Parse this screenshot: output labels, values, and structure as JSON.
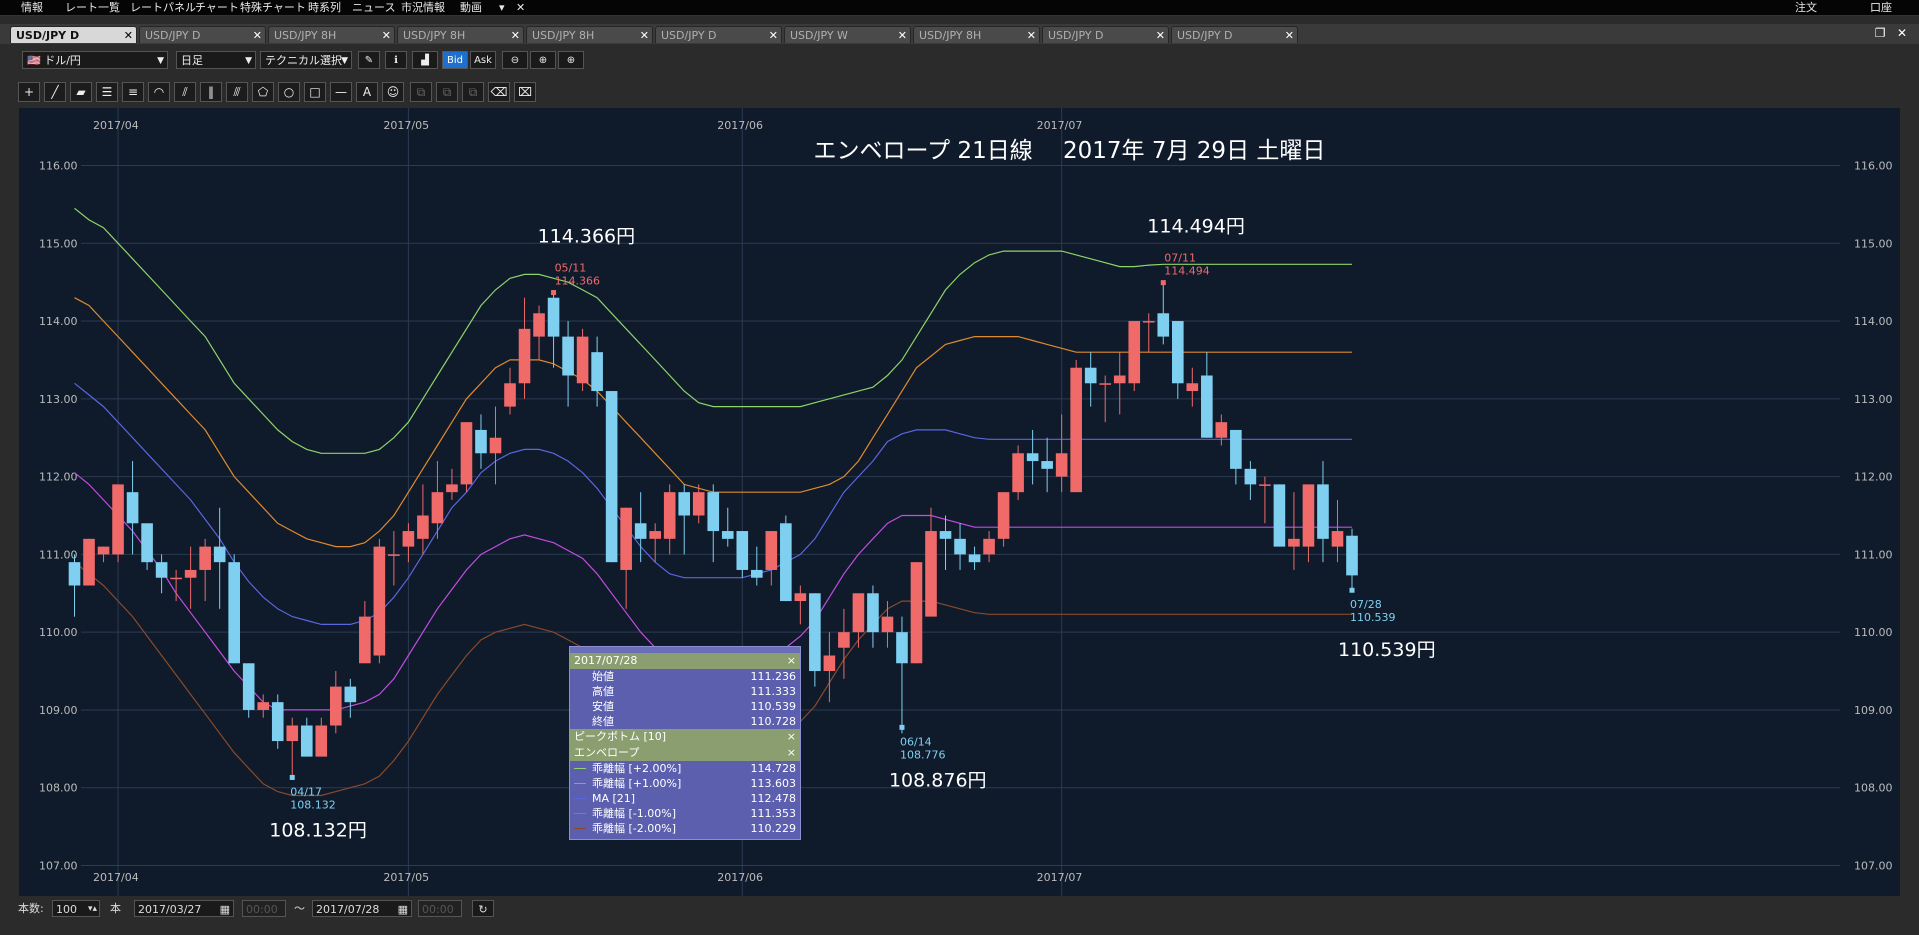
{
  "menubar": {
    "items": [
      "情報",
      "レート一覧",
      "レートパネル",
      "チャート",
      "特殊チャート",
      "時系列",
      "ニュース",
      "市況情報",
      "動画",
      "▾",
      "✕"
    ],
    "right": [
      "注文",
      "口座"
    ]
  },
  "tabs": [
    {
      "label": "USD/JPY D",
      "active": true
    },
    {
      "label": "USD/JPY D",
      "active": false
    },
    {
      "label": "USD/JPY 8H",
      "active": false
    },
    {
      "label": "USD/JPY 8H",
      "active": false
    },
    {
      "label": "USD/JPY 8H",
      "active": false
    },
    {
      "label": "USD/JPY D",
      "active": false
    },
    {
      "label": "USD/JPY W",
      "active": false
    },
    {
      "label": "USD/JPY 8H",
      "active": false
    },
    {
      "label": "USD/JPY D",
      "active": false
    },
    {
      "label": "USD/JPY D",
      "active": false
    }
  ],
  "toolbar": {
    "pair": "ドル/円",
    "period": "日足",
    "tech": "テクニカル選択",
    "bid": "Bid",
    "ask": "Ask"
  },
  "status": {
    "count_label": "本数:",
    "count_value": "100",
    "unit": "本",
    "start_date": "2017/03/27",
    "start_time": "00:00",
    "tilde": "〜",
    "end_date": "2017/07/28",
    "end_time": "00:00"
  },
  "infopanel": {
    "date": "2017/07/28",
    "ohlc": [
      {
        "label": "始値",
        "value": "111.236"
      },
      {
        "label": "高値",
        "value": "111.333"
      },
      {
        "label": "安値",
        "value": "110.539"
      },
      {
        "label": "終値",
        "value": "110.728"
      }
    ],
    "peak_label": "ピークボトム [10]",
    "env_label": "エンベロープ",
    "env_rows": [
      {
        "label": "乖離幅 [+2.00%]",
        "value": "114.728",
        "color": "#8fd46a"
      },
      {
        "label": "乖離幅 [+1.00%]",
        "value": "113.603",
        "color": "#e08a2c"
      },
      {
        "label": "MA [21]",
        "value": "112.478",
        "color": "#5a66e0"
      },
      {
        "label": "乖離幅 [-1.00%]",
        "value": "111.353",
        "color": "#c24de0"
      },
      {
        "label": "乖離幅 [-2.00%]",
        "value": "110.229",
        "color": "#8a4a2a"
      }
    ]
  },
  "chart_data": {
    "type": "candlestick",
    "title": "エンベロープ 21日線　 2017年 7月 29日 土曜日",
    "ylim": [
      107,
      116
    ],
    "yticks": [
      "116.00",
      "115.00",
      "114.00",
      "113.00",
      "112.00",
      "111.00",
      "110.00",
      "109.00",
      "108.00",
      "107.00"
    ],
    "month_labels": [
      {
        "label": "2017/04",
        "index": 3
      },
      {
        "label": "2017/05",
        "index": 23
      },
      {
        "label": "2017/06",
        "index": 46
      },
      {
        "label": "2017/07",
        "index": 68
      }
    ],
    "up_color": "#f06a6a",
    "down_color": "#7fd0f0",
    "candles": [
      [
        110.9,
        110.6,
        111.0,
        110.2
      ],
      [
        110.6,
        111.2,
        111.2,
        110.6
      ],
      [
        111.0,
        111.1,
        111.1,
        110.9
      ],
      [
        111.0,
        111.9,
        111.9,
        110.9
      ],
      [
        111.8,
        111.4,
        112.2,
        111.0
      ],
      [
        111.4,
        110.9,
        111.4,
        110.8
      ],
      [
        110.9,
        110.7,
        111.0,
        110.5
      ],
      [
        110.7,
        110.7,
        110.8,
        110.4
      ],
      [
        110.7,
        110.8,
        111.1,
        110.3
      ],
      [
        110.8,
        111.1,
        111.2,
        110.4
      ],
      [
        111.1,
        110.9,
        111.6,
        110.3
      ],
      [
        110.9,
        109.6,
        111.0,
        109.6
      ],
      [
        109.6,
        109.0,
        109.6,
        108.9
      ],
      [
        109.0,
        109.1,
        109.2,
        108.9
      ],
      [
        109.1,
        108.6,
        109.2,
        108.5
      ],
      [
        108.6,
        108.8,
        108.9,
        108.1
      ],
      [
        108.8,
        108.4,
        108.9,
        108.4
      ],
      [
        108.4,
        108.8,
        108.9,
        108.4
      ],
      [
        108.8,
        109.3,
        109.5,
        108.7
      ],
      [
        109.3,
        109.1,
        109.4,
        108.9
      ],
      [
        109.6,
        110.2,
        110.4,
        109.6
      ],
      [
        109.7,
        111.1,
        111.2,
        109.6
      ],
      [
        111.0,
        111.0,
        111.3,
        110.6
      ],
      [
        111.1,
        111.3,
        111.4,
        110.9
      ],
      [
        111.2,
        111.5,
        111.9,
        111.0
      ],
      [
        111.4,
        111.8,
        112.2,
        111.2
      ],
      [
        111.8,
        111.9,
        112.1,
        111.7
      ],
      [
        111.9,
        112.7,
        112.7,
        111.8
      ],
      [
        112.6,
        112.3,
        112.8,
        112.1
      ],
      [
        112.3,
        112.5,
        112.9,
        111.9
      ],
      [
        112.9,
        113.2,
        113.4,
        112.8
      ],
      [
        113.2,
        113.9,
        114.3,
        113.0
      ],
      [
        113.8,
        114.1,
        114.2,
        113.5
      ],
      [
        114.3,
        113.8,
        114.4,
        113.4
      ],
      [
        113.8,
        113.3,
        114.0,
        112.9
      ],
      [
        113.2,
        113.8,
        113.9,
        113.1
      ],
      [
        113.6,
        113.1,
        113.8,
        112.9
      ],
      [
        113.1,
        110.9,
        113.1,
        110.9
      ],
      [
        110.8,
        111.6,
        111.6,
        110.3
      ],
      [
        111.4,
        111.2,
        111.8,
        110.9
      ],
      [
        111.2,
        111.3,
        111.4,
        110.9
      ],
      [
        111.2,
        111.8,
        111.9,
        111.0
      ],
      [
        111.8,
        111.5,
        111.9,
        111.0
      ],
      [
        111.5,
        111.8,
        111.9,
        111.4
      ],
      [
        111.8,
        111.3,
        111.9,
        110.9
      ],
      [
        111.3,
        111.2,
        111.6,
        111.1
      ],
      [
        111.3,
        110.8,
        111.3,
        110.7
      ],
      [
        110.8,
        110.7,
        111.1,
        110.6
      ],
      [
        110.8,
        111.3,
        111.3,
        110.6
      ],
      [
        111.4,
        110.4,
        111.5,
        110.4
      ],
      [
        110.4,
        110.5,
        110.6,
        110.1
      ],
      [
        110.5,
        109.5,
        110.5,
        109.3
      ],
      [
        109.5,
        109.7,
        110.0,
        109.1
      ],
      [
        109.8,
        110.0,
        110.3,
        109.4
      ],
      [
        110.0,
        110.5,
        110.5,
        109.8
      ],
      [
        110.5,
        110.0,
        110.6,
        109.8
      ],
      [
        110.0,
        110.2,
        110.4,
        109.8
      ],
      [
        110.0,
        109.6,
        110.2,
        108.7
      ],
      [
        109.6,
        110.9,
        110.9,
        109.6
      ],
      [
        110.2,
        111.3,
        111.6,
        110.2
      ],
      [
        111.3,
        111.2,
        111.5,
        110.8
      ],
      [
        111.2,
        111.0,
        111.4,
        110.8
      ],
      [
        111.0,
        110.9,
        111.1,
        110.8
      ],
      [
        111.0,
        111.2,
        111.3,
        110.9
      ],
      [
        111.2,
        111.8,
        111.8,
        111.1
      ],
      [
        111.8,
        112.3,
        112.4,
        111.7
      ],
      [
        112.3,
        112.2,
        112.6,
        111.9
      ],
      [
        112.2,
        112.1,
        112.5,
        111.8
      ],
      [
        112.0,
        112.3,
        112.8,
        111.8
      ],
      [
        111.8,
        113.4,
        113.5,
        111.8
      ],
      [
        113.4,
        113.2,
        113.6,
        112.9
      ],
      [
        113.2,
        113.2,
        113.3,
        112.7
      ],
      [
        113.2,
        113.3,
        113.6,
        112.8
      ],
      [
        113.2,
        114.0,
        114.0,
        113.1
      ],
      [
        114.0,
        114.0,
        114.1,
        113.6
      ],
      [
        114.1,
        113.8,
        114.5,
        113.7
      ],
      [
        114.0,
        113.2,
        114.0,
        113.0
      ],
      [
        113.1,
        113.2,
        113.4,
        112.9
      ],
      [
        113.3,
        112.5,
        113.6,
        112.5
      ],
      [
        112.5,
        112.7,
        112.8,
        112.4
      ],
      [
        112.6,
        112.1,
        112.6,
        111.9
      ],
      [
        112.1,
        111.9,
        112.2,
        111.7
      ],
      [
        111.9,
        111.9,
        112.0,
        111.4
      ],
      [
        111.9,
        111.1,
        111.9,
        111.1
      ],
      [
        111.1,
        111.2,
        111.8,
        110.8
      ],
      [
        111.1,
        111.9,
        111.9,
        110.9
      ],
      [
        111.9,
        111.2,
        112.2,
        110.9
      ],
      [
        111.1,
        111.3,
        111.7,
        110.9
      ],
      [
        111.24,
        110.73,
        111.33,
        110.54
      ]
    ],
    "envelopes": [
      {
        "name": "乖離幅 [+2.00%]",
        "color": "#8fd46a",
        "values": [
          115.45,
          115.3,
          115.2,
          115.0,
          114.8,
          114.6,
          114.4,
          114.2,
          114.0,
          113.8,
          113.5,
          113.2,
          113.0,
          112.8,
          112.6,
          112.45,
          112.35,
          112.3,
          112.3,
          112.3,
          112.3,
          112.35,
          112.5,
          112.7,
          113.0,
          113.3,
          113.6,
          113.9,
          114.2,
          114.4,
          114.55,
          114.6,
          114.6,
          114.55,
          114.5,
          114.4,
          114.3,
          114.1,
          113.9,
          113.7,
          113.5,
          113.3,
          113.1,
          112.95,
          112.9,
          112.9,
          112.9,
          112.9,
          112.9,
          112.9,
          112.9,
          112.95,
          113.0,
          113.05,
          113.1,
          113.15,
          113.3,
          113.5,
          113.8,
          114.1,
          114.4,
          114.6,
          114.75,
          114.85,
          114.9,
          114.9,
          114.9,
          114.9,
          114.9,
          114.85,
          114.8,
          114.75,
          114.7,
          114.7,
          114.72,
          114.73,
          114.73,
          114.73,
          114.73,
          114.73,
          114.73,
          114.73,
          114.73,
          114.73,
          114.73,
          114.73,
          114.73,
          114.73,
          114.73
        ],
        "note": ""
      },
      {
        "name": "乖離幅 [+1.00%]",
        "color": "#e08a2c",
        "values": [
          114.3,
          114.2,
          114.0,
          113.8,
          113.6,
          113.4,
          113.2,
          113.0,
          112.8,
          112.6,
          112.3,
          112.0,
          111.8,
          111.6,
          111.4,
          111.3,
          111.2,
          111.15,
          111.1,
          111.1,
          111.15,
          111.3,
          111.5,
          111.8,
          112.1,
          112.4,
          112.7,
          113.0,
          113.2,
          113.4,
          113.5,
          113.5,
          113.5,
          113.45,
          113.35,
          113.25,
          113.1,
          112.9,
          112.7,
          112.5,
          112.3,
          112.1,
          111.9,
          111.85,
          111.8,
          111.8,
          111.8,
          111.8,
          111.8,
          111.8,
          111.8,
          111.85,
          111.9,
          112.0,
          112.2,
          112.5,
          112.8,
          113.1,
          113.4,
          113.55,
          113.7,
          113.75,
          113.8,
          113.8,
          113.8,
          113.8,
          113.75,
          113.7,
          113.65,
          113.6,
          113.6,
          113.6,
          113.6,
          113.6,
          113.6,
          113.6,
          113.6,
          113.6,
          113.6,
          113.6,
          113.6,
          113.6,
          113.6,
          113.6,
          113.6,
          113.6,
          113.6,
          113.6,
          113.6
        ]
      },
      {
        "name": "MA [21]",
        "color": "#5a66e0",
        "values": [
          113.2,
          113.05,
          112.9,
          112.7,
          112.5,
          112.3,
          112.1,
          111.9,
          111.7,
          111.45,
          111.2,
          110.9,
          110.65,
          110.45,
          110.3,
          110.2,
          110.15,
          110.1,
          110.1,
          110.1,
          110.15,
          110.25,
          110.45,
          110.7,
          111.0,
          111.3,
          111.6,
          111.8,
          112.05,
          112.2,
          112.3,
          112.35,
          112.35,
          112.3,
          112.2,
          112.05,
          111.85,
          111.6,
          111.35,
          111.1,
          110.9,
          110.75,
          110.7,
          110.7,
          110.7,
          110.7,
          110.7,
          110.75,
          110.8,
          110.9,
          111.0,
          111.2,
          111.5,
          111.8,
          112.0,
          112.2,
          112.45,
          112.55,
          112.6,
          112.6,
          112.6,
          112.55,
          112.5,
          112.48,
          112.48,
          112.48,
          112.48,
          112.48,
          112.48,
          112.48,
          112.48,
          112.48,
          112.48,
          112.48,
          112.48,
          112.48,
          112.48,
          112.48,
          112.48,
          112.48,
          112.48,
          112.48,
          112.48,
          112.48,
          112.48,
          112.48,
          112.48,
          112.48,
          112.48
        ]
      },
      {
        "name": "乖離幅 [-1.00%]",
        "color": "#c24de0",
        "values": [
          112.05,
          111.9,
          111.7,
          111.5,
          111.3,
          111.05,
          110.8,
          110.5,
          110.25,
          110.0,
          109.75,
          109.5,
          109.3,
          109.1,
          109.0,
          109.0,
          109.0,
          109.0,
          109.0,
          109.05,
          109.1,
          109.2,
          109.4,
          109.7,
          110.0,
          110.3,
          110.55,
          110.8,
          111.0,
          111.1,
          111.2,
          111.25,
          111.2,
          111.15,
          111.05,
          110.95,
          110.75,
          110.5,
          110.25,
          110.0,
          109.8,
          109.65,
          109.6,
          109.6,
          109.6,
          109.6,
          109.6,
          109.65,
          109.7,
          109.8,
          109.95,
          110.15,
          110.45,
          110.75,
          111.0,
          111.2,
          111.4,
          111.5,
          111.5,
          111.5,
          111.45,
          111.4,
          111.35,
          111.35,
          111.35,
          111.35,
          111.35,
          111.35,
          111.35,
          111.35,
          111.35,
          111.35,
          111.35,
          111.35,
          111.35,
          111.35,
          111.35,
          111.35,
          111.35,
          111.35,
          111.35,
          111.35,
          111.35,
          111.35,
          111.35,
          111.35,
          111.35,
          111.35,
          111.35
        ]
      },
      {
        "name": "乖離幅 [-2.00%]",
        "color": "#8a4a2a",
        "values": [
          110.9,
          110.75,
          110.6,
          110.4,
          110.2,
          109.95,
          109.7,
          109.45,
          109.2,
          108.95,
          108.7,
          108.45,
          108.25,
          108.05,
          107.95,
          107.9,
          107.9,
          107.9,
          107.95,
          108.0,
          108.05,
          108.15,
          108.35,
          108.6,
          108.9,
          109.2,
          109.45,
          109.7,
          109.9,
          110.0,
          110.05,
          110.1,
          110.05,
          110.0,
          109.9,
          109.8,
          109.6,
          109.35,
          109.1,
          108.9,
          108.7,
          108.55,
          108.5,
          108.5,
          108.5,
          108.5,
          108.5,
          108.55,
          108.6,
          108.7,
          108.85,
          109.05,
          109.35,
          109.65,
          109.9,
          110.1,
          110.3,
          110.4,
          110.4,
          110.4,
          110.35,
          110.3,
          110.25,
          110.23,
          110.23,
          110.23,
          110.23,
          110.23,
          110.23,
          110.23,
          110.23,
          110.23,
          110.23,
          110.23,
          110.23,
          110.23,
          110.23,
          110.23,
          110.23,
          110.23,
          110.23,
          110.23,
          110.23,
          110.23,
          110.23,
          110.23,
          110.23,
          110.23,
          110.23
        ]
      }
    ],
    "peaks": [
      {
        "index": 15,
        "date": "04/17",
        "value": "108.132",
        "big": "108.132円",
        "type": "low"
      },
      {
        "index": 33,
        "date": "05/11",
        "value": "114.366",
        "big": "114.366円",
        "type": "high"
      },
      {
        "index": 57,
        "date": "06/14",
        "value": "108.776",
        "big": "108.876円",
        "type": "low"
      },
      {
        "index": 75,
        "date": "07/11",
        "value": "114.494",
        "big": "114.494円",
        "type": "high"
      },
      {
        "index": 88,
        "date": "07/28",
        "value": "110.539",
        "big": "110.539円",
        "type": "low"
      }
    ]
  }
}
